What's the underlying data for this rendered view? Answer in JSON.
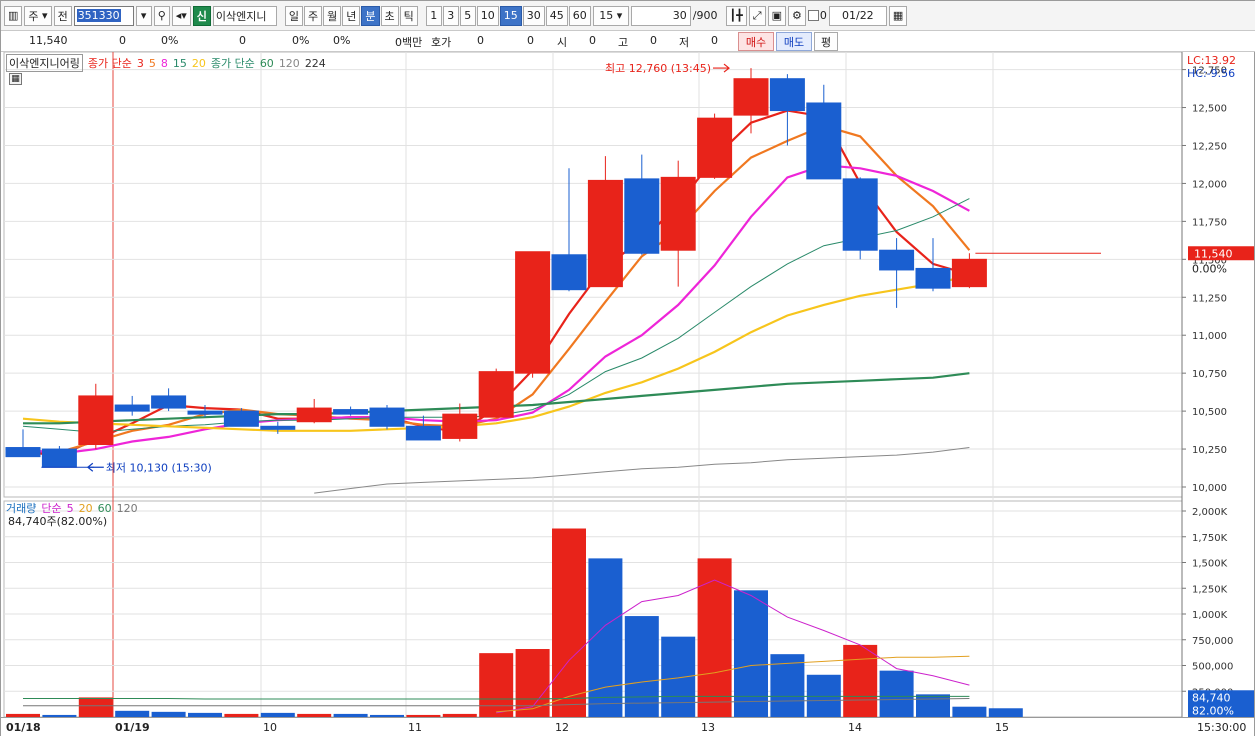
{
  "toolbar": {
    "market_select": "주",
    "prev_label": "전",
    "code": "351330",
    "badge": "신",
    "stock_name": "이삭엔지니",
    "periods": [
      "일",
      "주",
      "월",
      "년",
      "분",
      "초",
      "틱"
    ],
    "selected_period": "분",
    "intervals": [
      "1",
      "3",
      "5",
      "10",
      "15",
      "30",
      "45",
      "60"
    ],
    "selected_interval": "15",
    "interval_value": "15",
    "count": "30",
    "count_total": "/900",
    "checkbox_label": "0",
    "date": "01/22"
  },
  "infobar": {
    "price": "11,540",
    "change": "0",
    "change_pct": "0%",
    "volume": "0",
    "vol_pct": "0%",
    "pct2": "0%",
    "amount": "0백만",
    "quote_label": "호가",
    "quote_val1": "0",
    "quote_val2": "0",
    "open_label": "시",
    "open_val": "0",
    "high_label": "고",
    "high_val": "0",
    "low_label": "저",
    "low_val": "0",
    "buy_label": "매수",
    "sell_label": "매도",
    "avg_label": "평"
  },
  "price_panel": {
    "name": "이삭엔지니어링",
    "ma_short_title": "종가 단순",
    "ma_short_periods": [
      "3",
      "5",
      "8",
      "15",
      "20"
    ],
    "ma_long_title": "종가 단순",
    "ma_long_periods": [
      "60",
      "120",
      "224"
    ],
    "lc_label": "LC:13.92",
    "hc_label": "HC:-9.56",
    "high_annotation": "최고 12,760 (13:45)",
    "low_annotation": "최저 10,130 (15:30)",
    "current_price_tag": "11,540",
    "current_pct_tag": "0.00%",
    "price_ticks": [
      "12,750",
      "12,500",
      "12,250",
      "12,000",
      "11,750",
      "11,500",
      "11,250",
      "11,000",
      "10,750",
      "10,500",
      "10,250",
      "10,000"
    ]
  },
  "volume_panel": {
    "title": "거래량",
    "ma_title": "단순",
    "ma_periods": [
      "5",
      "20",
      "60",
      "120"
    ],
    "current": "84,740주(82.00%)",
    "volume_ticks": [
      "2,000K",
      "1,750K",
      "1,500K",
      "1,250K",
      "1,000K",
      "750,000",
      "500,000",
      "250,000"
    ],
    "current_tag": "84,740",
    "current_pct_tag": "82.00%"
  },
  "time_axis": {
    "labels": [
      "01/18",
      "01/19",
      "10",
      "11",
      "12",
      "13",
      "14",
      "15"
    ],
    "right_label": "15:30:00"
  },
  "chart_data": {
    "type": "candlestick",
    "y_range": [
      10000,
      12800
    ],
    "volume_range": [
      0,
      2000000
    ],
    "candles": [
      {
        "o": 10260,
        "h": 10380,
        "l": 10200,
        "c": 10200
      },
      {
        "o": 10250,
        "h": 10270,
        "l": 10130,
        "c": 10130
      },
      {
        "o": 10280,
        "h": 10680,
        "l": 10250,
        "c": 10600
      },
      {
        "o": 10540,
        "h": 10600,
        "l": 10470,
        "c": 10500
      },
      {
        "o": 10600,
        "h": 10650,
        "l": 10500,
        "c": 10520
      },
      {
        "o": 10500,
        "h": 10540,
        "l": 10460,
        "c": 10480
      },
      {
        "o": 10500,
        "h": 10520,
        "l": 10400,
        "c": 10400
      },
      {
        "o": 10400,
        "h": 10430,
        "l": 10350,
        "c": 10380
      },
      {
        "o": 10430,
        "h": 10580,
        "l": 10420,
        "c": 10520
      },
      {
        "o": 10510,
        "h": 10530,
        "l": 10470,
        "c": 10480
      },
      {
        "o": 10520,
        "h": 10540,
        "l": 10380,
        "c": 10400
      },
      {
        "o": 10400,
        "h": 10470,
        "l": 10310,
        "c": 10310
      },
      {
        "o": 10320,
        "h": 10550,
        "l": 10300,
        "c": 10480
      },
      {
        "o": 10460,
        "h": 10780,
        "l": 10460,
        "c": 10760
      },
      {
        "o": 10750,
        "h": 11030,
        "l": 10720,
        "c": 11550
      },
      {
        "o": 11530,
        "h": 12100,
        "l": 11290,
        "c": 11300
      },
      {
        "o": 11320,
        "h": 12180,
        "l": 11320,
        "c": 12020
      },
      {
        "o": 12030,
        "h": 12190,
        "l": 11530,
        "c": 11540
      },
      {
        "o": 11560,
        "h": 12150,
        "l": 11320,
        "c": 12040
      },
      {
        "o": 12040,
        "h": 12460,
        "l": 12030,
        "c": 12430
      },
      {
        "o": 12450,
        "h": 12760,
        "l": 12330,
        "c": 12690
      },
      {
        "o": 12690,
        "h": 12720,
        "l": 12250,
        "c": 12480
      },
      {
        "o": 12530,
        "h": 12650,
        "l": 12050,
        "c": 12030
      },
      {
        "o": 12030,
        "h": 12040,
        "l": 11500,
        "c": 11560
      },
      {
        "o": 11560,
        "h": 11640,
        "l": 11180,
        "c": 11430
      },
      {
        "o": 11440,
        "h": 11640,
        "l": 11290,
        "c": 11310
      },
      {
        "o": 11320,
        "h": 11540,
        "l": 11310,
        "c": 11500
      }
    ],
    "volumes": [
      30000,
      20000,
      190000,
      60000,
      50000,
      40000,
      30000,
      40000,
      30000,
      30000,
      20000,
      20000,
      30000,
      620000,
      660000,
      1830000,
      1540000,
      980000,
      780000,
      1540000,
      1230000,
      610000,
      410000,
      700000,
      450000,
      220000,
      100000,
      84740
    ],
    "volume_colors": [
      "up",
      "down",
      "up",
      "down",
      "down",
      "down",
      "up",
      "down",
      "up",
      "down",
      "down",
      "up",
      "up",
      "up",
      "up",
      "up",
      "down",
      "down",
      "down",
      "up",
      "down",
      "down",
      "down",
      "up",
      "down",
      "down",
      "down",
      "down"
    ],
    "ma": [
      {
        "period": "3",
        "color": "#e8231a",
        "values": [
          10230,
          10210,
          10310,
          10420,
          10540,
          10520,
          10510,
          10450,
          10450,
          10460,
          10460,
          10400,
          10360,
          10520,
          10770,
          11140,
          11460,
          11620,
          11860,
          12170,
          12400,
          12480,
          12440,
          12000,
          11680,
          11470,
          11400
        ]
      },
      {
        "period": "5",
        "color": "#f07820",
        "values": [
          10240,
          10230,
          10300,
          10370,
          10410,
          10480,
          10510,
          10480,
          10470,
          10450,
          10440,
          10410,
          10400,
          10450,
          10610,
          10910,
          11220,
          11520,
          11690,
          11950,
          12170,
          12280,
          12380,
          12310,
          12050,
          11850,
          11560
        ]
      },
      {
        "period": "8",
        "color": "#ee25d8",
        "values": [
          10250,
          10220,
          10250,
          10300,
          10330,
          10380,
          10420,
          10440,
          10450,
          10460,
          10460,
          10440,
          10430,
          10440,
          10490,
          10640,
          10860,
          11000,
          11200,
          11460,
          11780,
          12040,
          12120,
          12100,
          12050,
          11950,
          11820
        ]
      },
      {
        "period": "15",
        "color": "#2a8a6a",
        "values": [
          10400,
          10380,
          10360,
          10380,
          10400,
          10410,
          10430,
          10440,
          10440,
          10450,
          10460,
          10460,
          10460,
          10470,
          10510,
          10610,
          10760,
          10850,
          10980,
          11150,
          11320,
          11470,
          11590,
          11640,
          11690,
          11780,
          11900
        ]
      },
      {
        "period": "20",
        "color": "#f7c51c",
        "values": [
          10450,
          10430,
          10420,
          10410,
          10400,
          10390,
          10380,
          10370,
          10370,
          10370,
          10380,
          10390,
          10400,
          10420,
          10460,
          10530,
          10620,
          10690,
          10780,
          10890,
          11020,
          11130,
          11200,
          11260,
          11300,
          11340,
          11390
        ]
      },
      {
        "period": "60",
        "color": "#2e8b57",
        "values": [
          10420,
          10420,
          10430,
          10440,
          10450,
          10460,
          10470,
          10480,
          10480,
          10490,
          10500,
          10510,
          10520,
          10530,
          10540,
          10560,
          10580,
          10600,
          10620,
          10640,
          10660,
          10680,
          10690,
          10700,
          10710,
          10720,
          10750
        ]
      },
      {
        "period": "120",
        "color": "#888888",
        "values": [
          null,
          null,
          null,
          null,
          null,
          null,
          null,
          null,
          9960,
          9990,
          10020,
          10030,
          10040,
          10050,
          10060,
          10080,
          10100,
          10120,
          10130,
          10150,
          10160,
          10180,
          10190,
          10200,
          10210,
          10230,
          10260
        ]
      }
    ],
    "volume_ma": [
      {
        "period": "5",
        "color": "#cc22cc",
        "values": [
          null,
          null,
          null,
          null,
          null,
          null,
          null,
          null,
          null,
          null,
          null,
          null,
          null,
          40000,
          100000,
          550000,
          890000,
          1120000,
          1180000,
          1330000,
          1180000,
          970000,
          840000,
          700000,
          470000,
          400000,
          310000
        ]
      },
      {
        "period": "20",
        "color": "#e2a020",
        "values": [
          null,
          null,
          null,
          null,
          null,
          null,
          null,
          null,
          null,
          null,
          null,
          null,
          null,
          50000,
          80000,
          200000,
          290000,
          340000,
          380000,
          430000,
          500000,
          520000,
          540000,
          560000,
          580000,
          580000,
          590000
        ]
      },
      {
        "period": "60",
        "color": "#2e8b57",
        "values": [
          180000,
          180000,
          180000,
          180000,
          180000,
          175000,
          175000,
          175000,
          175000,
          175000,
          175000,
          175000,
          175000,
          175000,
          175000,
          180000,
          190000,
          195000,
          200000,
          200000,
          200000,
          200000,
          200000,
          200000,
          200000,
          200000,
          200000
        ]
      },
      {
        "period": "120",
        "color": "#777777",
        "values": [
          110000,
          110000,
          110000,
          110000,
          110000,
          110000,
          110000,
          110000,
          110000,
          110000,
          110000,
          110000,
          110000,
          110000,
          110000,
          120000,
          130000,
          135000,
          140000,
          145000,
          150000,
          155000,
          160000,
          165000,
          170000,
          175000,
          180000
        ]
      }
    ]
  }
}
